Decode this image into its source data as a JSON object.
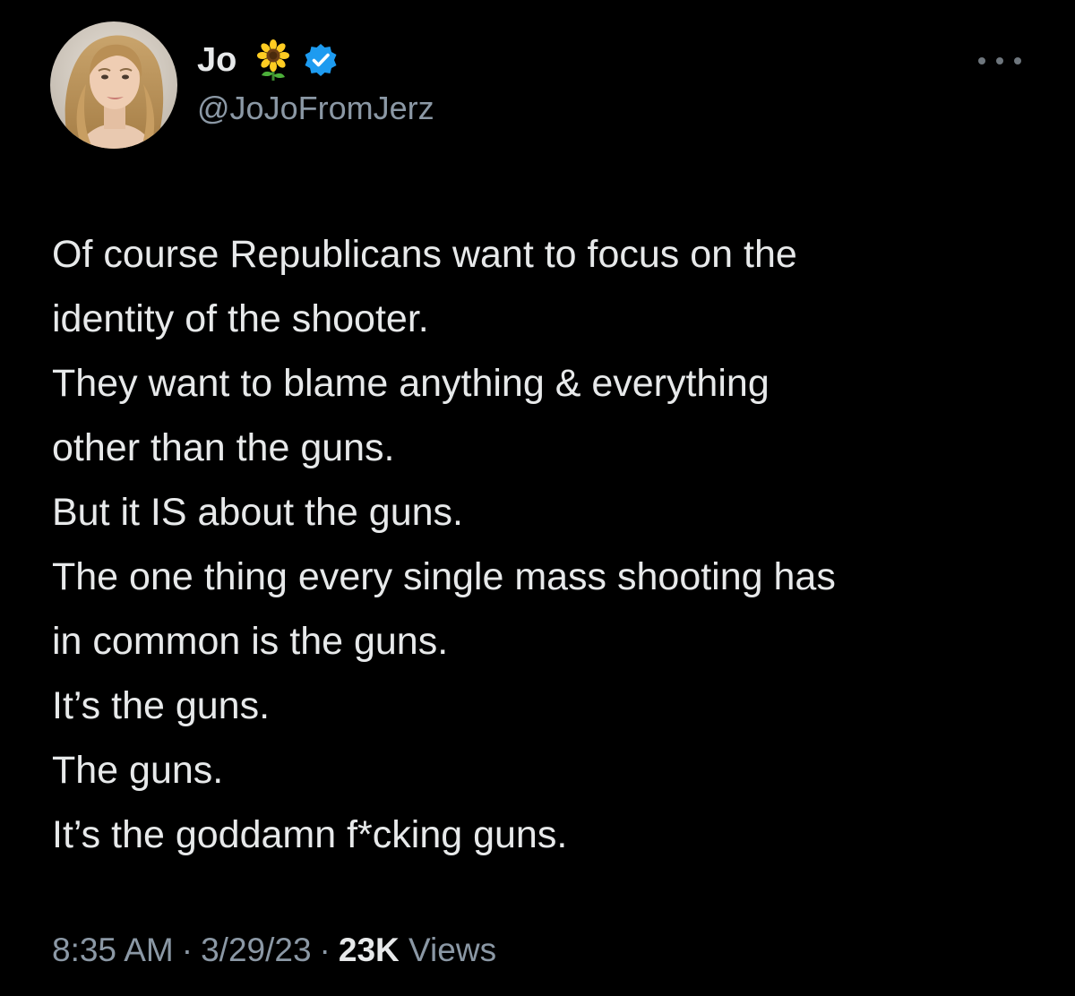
{
  "user": {
    "display_name": "Jo",
    "name_emoji": "🌻",
    "handle": "@JoJoFromJerz",
    "verified": true,
    "verified_color": "#1d9bf0"
  },
  "tweet": {
    "lines": [
      "Of course Republicans want to focus on the",
      "identity of the shooter.",
      "They want to blame anything & everything",
      "other than the guns.",
      "But it IS about the guns.",
      "The one thing every single mass shooting has",
      "in common is the guns.",
      "It’s the guns.",
      "The guns.",
      "It’s the goddamn f*cking guns."
    ]
  },
  "meta": {
    "time": "8:35 AM",
    "date": "3/29/23",
    "views_count": "23K",
    "views_label": "Views",
    "separator": "·"
  },
  "icons": {
    "more": "more-horizontal-icon",
    "verified": "verified-badge-icon",
    "emoji": "sunflower-emoji-icon"
  },
  "colors": {
    "background": "#000000",
    "text_primary": "#e7e9ea",
    "text_secondary": "#8b98a5"
  }
}
